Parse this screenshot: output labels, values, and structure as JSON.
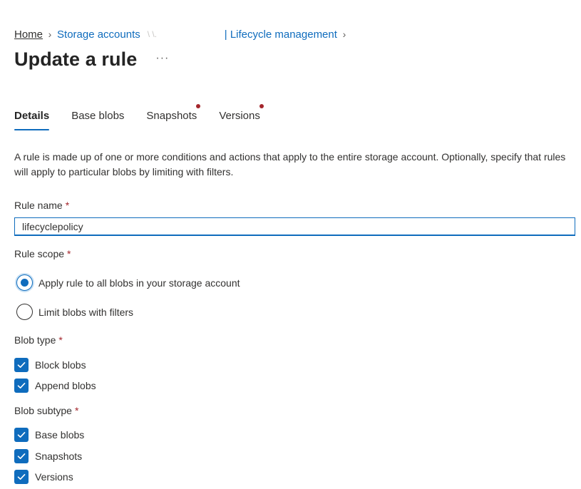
{
  "breadcrumb": {
    "home": "Home",
    "storage_accounts": "Storage accounts",
    "account_redacted": "\\ \\.",
    "lifecycle": "| Lifecycle management"
  },
  "header": {
    "title": "Update a rule",
    "more": "···"
  },
  "tabs": [
    {
      "label": "Details",
      "active": true,
      "indicator": false
    },
    {
      "label": "Base blobs",
      "active": false,
      "indicator": false
    },
    {
      "label": "Snapshots",
      "active": false,
      "indicator": true
    },
    {
      "label": "Versions",
      "active": false,
      "indicator": true
    }
  ],
  "description": "A rule is made up of one or more conditions and actions that apply to the entire storage account. Optionally, specify that rules will apply to particular blobs by limiting with filters.",
  "rule_name": {
    "label": "Rule name",
    "required": "*",
    "value": "lifecyclepolicy"
  },
  "rule_scope": {
    "label": "Rule scope",
    "required": "*",
    "options": [
      {
        "label": "Apply rule to all blobs in your storage account",
        "checked": true
      },
      {
        "label": "Limit blobs with filters",
        "checked": false
      }
    ]
  },
  "blob_type": {
    "label": "Blob type",
    "required": "*",
    "options": [
      {
        "label": "Block blobs",
        "checked": true
      },
      {
        "label": "Append blobs",
        "checked": true
      }
    ]
  },
  "blob_subtype": {
    "label": "Blob subtype",
    "required": "*",
    "options": [
      {
        "label": "Base blobs",
        "checked": true
      },
      {
        "label": "Snapshots",
        "checked": true
      },
      {
        "label": "Versions",
        "checked": true
      }
    ]
  },
  "colors": {
    "accent": "#0f6cbd",
    "required": "#a4262c",
    "text": "#323130"
  }
}
